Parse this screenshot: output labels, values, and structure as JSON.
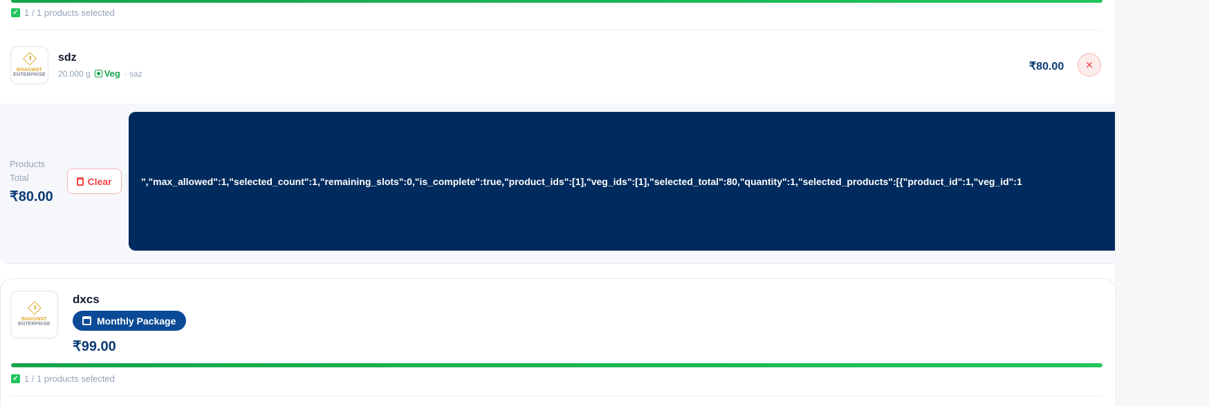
{
  "top_bundle": {
    "progress_fraction": 1.0,
    "selected_text": "1 / 1 products selected",
    "item": {
      "name": "sdz",
      "weight": "20.000 g",
      "veg_label": "Veg",
      "variant": "· saz",
      "price": "₹80.00",
      "remove_symbol": "✕",
      "logo_line1": "BHAGWAT",
      "logo_line2": "ENTERPRISE"
    }
  },
  "summary": {
    "label_line1": "Products",
    "label_line2": "Total",
    "total": "₹80.00",
    "clear_label": "Clear",
    "json_debug": "\",\"max_allowed\":1,\"selected_count\":1,\"remaining_slots\":0,\"is_complete\":true,\"product_ids\":[1],\"veg_ids\":[1],\"selected_total\":80,\"quantity\":1,\"selected_products\":[{\"product_id\":1,\"veg_id\":1"
  },
  "package_card": {
    "name": "dxcs",
    "badge": "Monthly Package",
    "price": "₹99.00",
    "progress_fraction": 1.0,
    "selected_text": "1 / 1 products selected",
    "logo_line1": "BHAGWAT",
    "logo_line2": "ENTERPRISE"
  },
  "colors": {
    "accent": "#0b4a96",
    "progress": "#22c55e",
    "danger": "#ef4444",
    "code_bg": "#002b5e"
  }
}
